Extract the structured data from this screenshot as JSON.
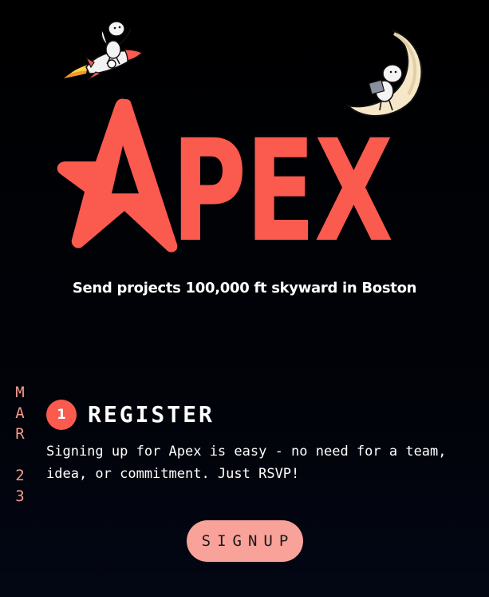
{
  "hero": {
    "logo_letters": "PEX",
    "logo_alt_name": "Apex",
    "tagline": "Send projects 100,000 ft skyward in Boston",
    "accent_color": "#fb5a4f",
    "decor": [
      "rocket-with-character-icon",
      "moon-with-character-icon"
    ]
  },
  "schedule": {
    "date_chars": [
      "M",
      "A",
      "R",
      "",
      "2",
      "3"
    ],
    "date_color": "#f59a8c"
  },
  "step": {
    "number": "1",
    "title": "REGISTER",
    "body": "Signing up for Apex is easy - no need for a team, idea, or commitment. Just RSVP!"
  },
  "cta": {
    "signup_label": "SIGNUP",
    "button_color": "#f9a29a"
  }
}
